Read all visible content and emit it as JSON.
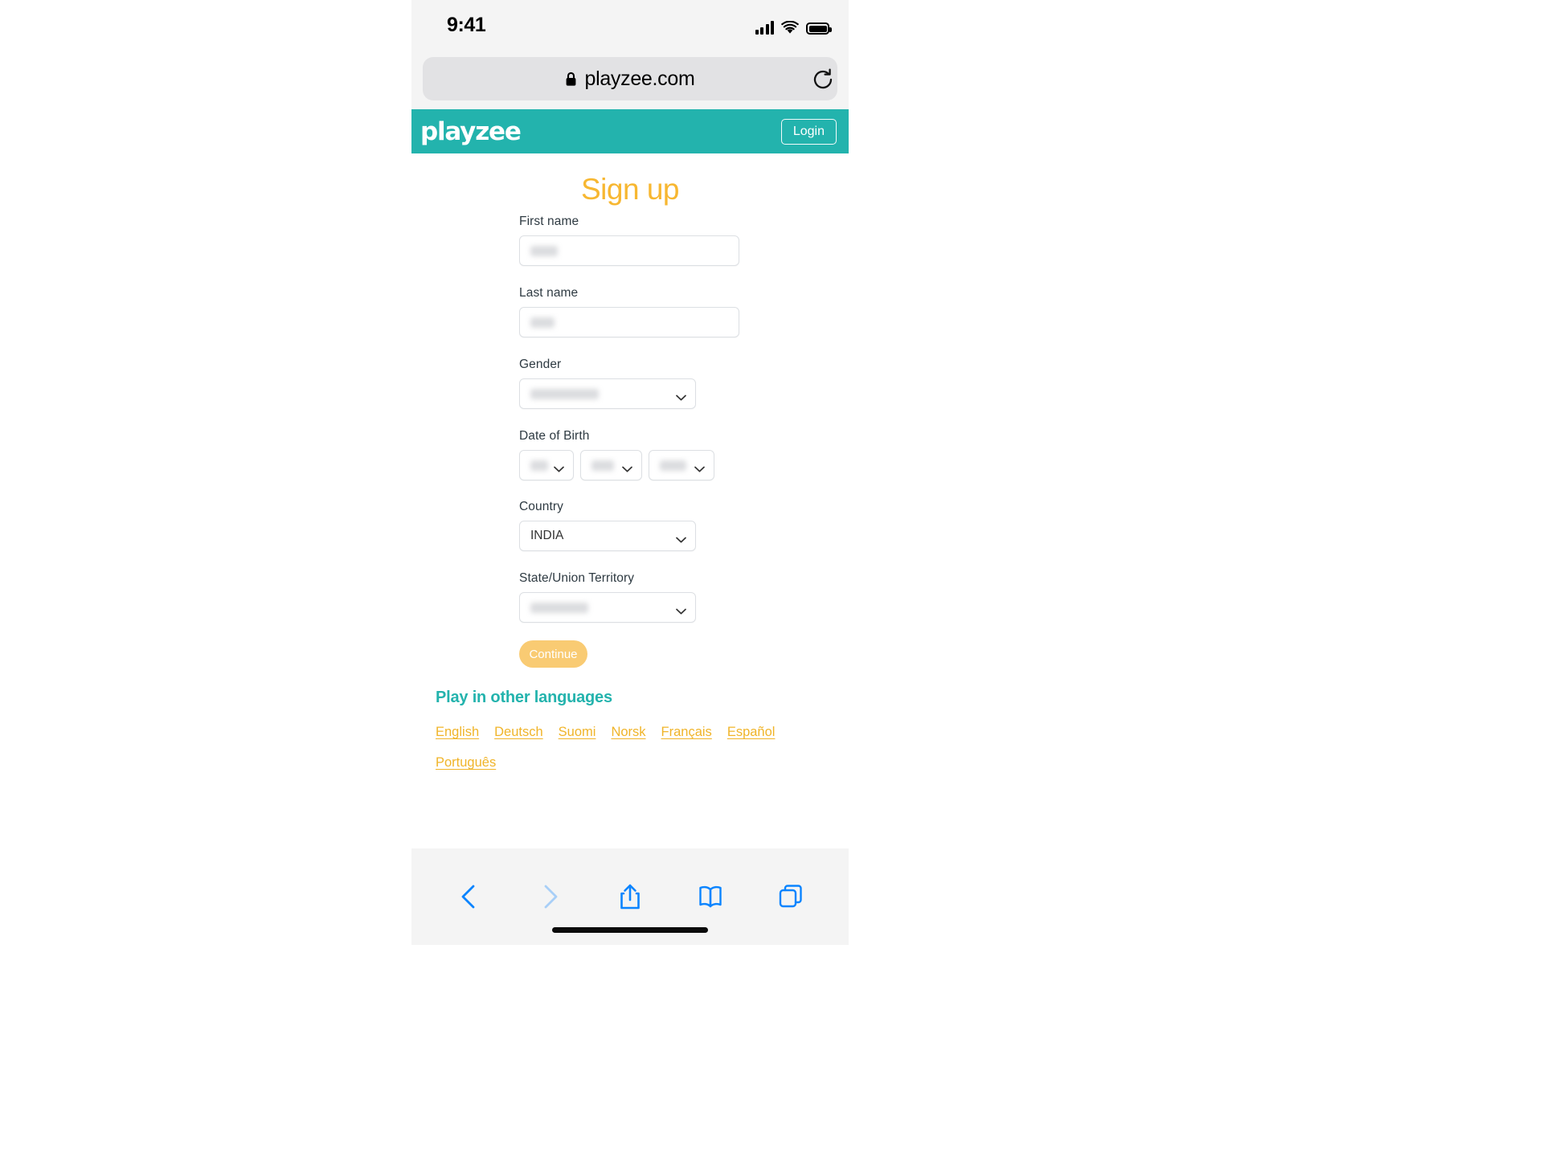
{
  "status_bar": {
    "time": "9:41",
    "signal_icon": "cellular-signal-icon",
    "wifi_icon": "wifi-icon",
    "battery_icon": "battery-full-icon"
  },
  "browser": {
    "url": "playzee.com",
    "lock_icon": "lock-icon",
    "reload_icon": "reload-icon",
    "toolbar": {
      "back_icon": "back-chevron-icon",
      "forward_icon": "forward-chevron-icon",
      "share_icon": "share-icon",
      "bookmarks_icon": "book-icon",
      "tabs_icon": "tabs-icon"
    }
  },
  "site_header": {
    "logo_text": "playzee",
    "login_label": "Login",
    "background_color": "#23b3ad"
  },
  "signup": {
    "title": "Sign up",
    "title_color": "#f7b731",
    "fields": {
      "first_name": {
        "label": "First name",
        "value": ""
      },
      "last_name": {
        "label": "Last name",
        "value": ""
      },
      "gender": {
        "label": "Gender",
        "value": ""
      },
      "date_of_birth": {
        "label": "Date of Birth",
        "day": "",
        "month": "",
        "year": ""
      },
      "country": {
        "label": "Country",
        "value": "INDIA"
      },
      "state": {
        "label": "State/Union Territory",
        "value": ""
      }
    },
    "continue_label": "Continue",
    "continue_color": "#f9cb73"
  },
  "languages": {
    "heading": "Play in other languages",
    "heading_color": "#23b3ad",
    "link_color": "#f0b429",
    "items": [
      {
        "label": "English"
      },
      {
        "label": "Deutsch"
      },
      {
        "label": "Suomi"
      },
      {
        "label": "Norsk"
      },
      {
        "label": "Français"
      },
      {
        "label": "Español"
      },
      {
        "label": "Português"
      }
    ]
  }
}
